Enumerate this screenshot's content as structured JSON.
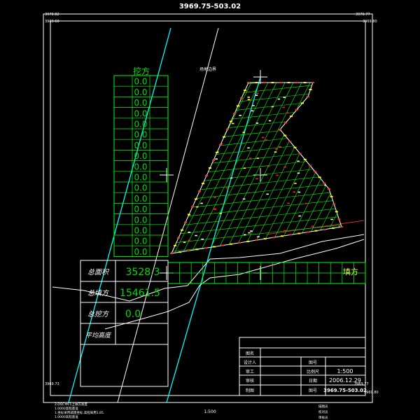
{
  "drawing": {
    "title": "3969.75-503.02",
    "scale_caption": "1:500",
    "corner_labels": {
      "top_left_a": "3970.82",
      "top_left_b": "3969.60",
      "top_right_a": "3970.77",
      "top_right_b": "3969.80",
      "bottom_left": "3969.73",
      "bottom_right_a": "3969.77",
      "bottom_right_b": "3969.80"
    },
    "boundary_label": "场地边界",
    "notes": [
      "2.DOC中F1上填方高度",
      "1.0000高程基准",
      "1.坐标采用城建坐标,高程采用1.85.",
      "1.0000高程基准"
    ],
    "footer_marks": [
      "描图员",
      "校对员",
      "审核员"
    ]
  },
  "wa_column": {
    "header": "挖方",
    "values": [
      "0.0",
      "0.0",
      "0.0",
      "0.0",
      "0.0",
      "0.0",
      "0.0",
      "0.0",
      "0.0",
      "0.0",
      "0.0",
      "0.0",
      "0.0",
      "0.0",
      "0.0",
      "0.0",
      "0.0"
    ]
  },
  "tian_row": {
    "header": "填方",
    "values": [
      "",
      "",
      "",
      "",
      "",
      "",
      "",
      "",
      "",
      "",
      "",
      "",
      "",
      "",
      "",
      "",
      ""
    ]
  },
  "summary": {
    "rows": [
      {
        "label": "总面积",
        "value": "3528.3"
      },
      {
        "label": "总填方",
        "value": "15461.5"
      },
      {
        "label": "总挖方",
        "value": "0.0"
      },
      {
        "label": "平均高度",
        "value": ""
      }
    ]
  },
  "title_block": {
    "rows": [
      {
        "l1": "图名",
        "v1": "",
        "l2": "",
        "v2": ""
      },
      {
        "l1": "设计人",
        "v1": "",
        "l2": "图号",
        "v2": ""
      },
      {
        "l1": "审工",
        "v1": "",
        "l2": "比例尺",
        "v2": "1:500"
      },
      {
        "l1": "审核",
        "v1": "",
        "l2": "日期",
        "v2": "2006.12.29"
      },
      {
        "l1": "制图",
        "v1": "",
        "l2": "图号",
        "v2": "3969.75-503.02"
      }
    ]
  },
  "colors": {
    "background": "#000000",
    "frame": "#ffffff",
    "grid": "#00ff00",
    "boundary": "#00ffff",
    "road": "#ffffff",
    "mark": "#ff2020",
    "point": "#ffff00"
  }
}
